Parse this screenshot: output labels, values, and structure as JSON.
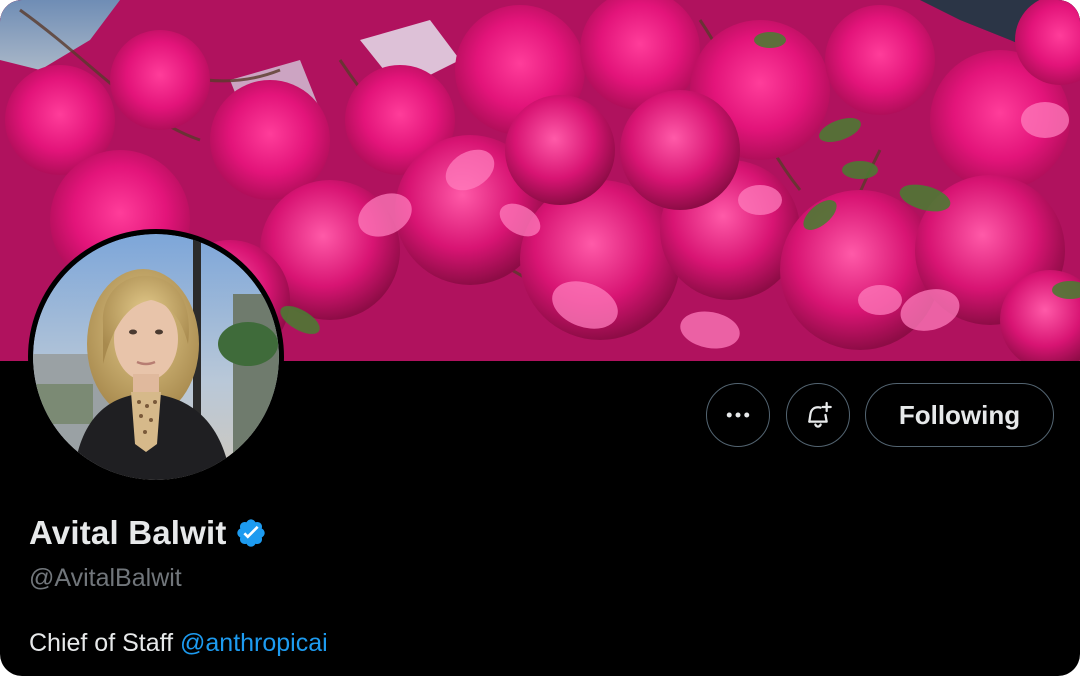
{
  "profile": {
    "display_name": "Avital Balwit",
    "handle": "@AvitalBalwit",
    "verified": true,
    "bio_text": "Chief of Staff ",
    "bio_mention": "@anthropicai"
  },
  "actions": {
    "more_icon": "more-horizontal-icon",
    "notify_icon": "bell-plus-icon",
    "following_label": "Following"
  },
  "banner": {
    "subject": "magenta bougainvillea flowers",
    "accent_color": "#e3147a"
  },
  "avatar": {
    "subject": "profile photo of a person with wavy blonde hair in a dark cardigan"
  },
  "colors": {
    "background": "#000000",
    "text_primary": "#e7e9ea",
    "text_secondary": "#71767b",
    "link": "#1d9bf0",
    "verified_badge": "#1d9bf0",
    "button_border": "#536471"
  }
}
